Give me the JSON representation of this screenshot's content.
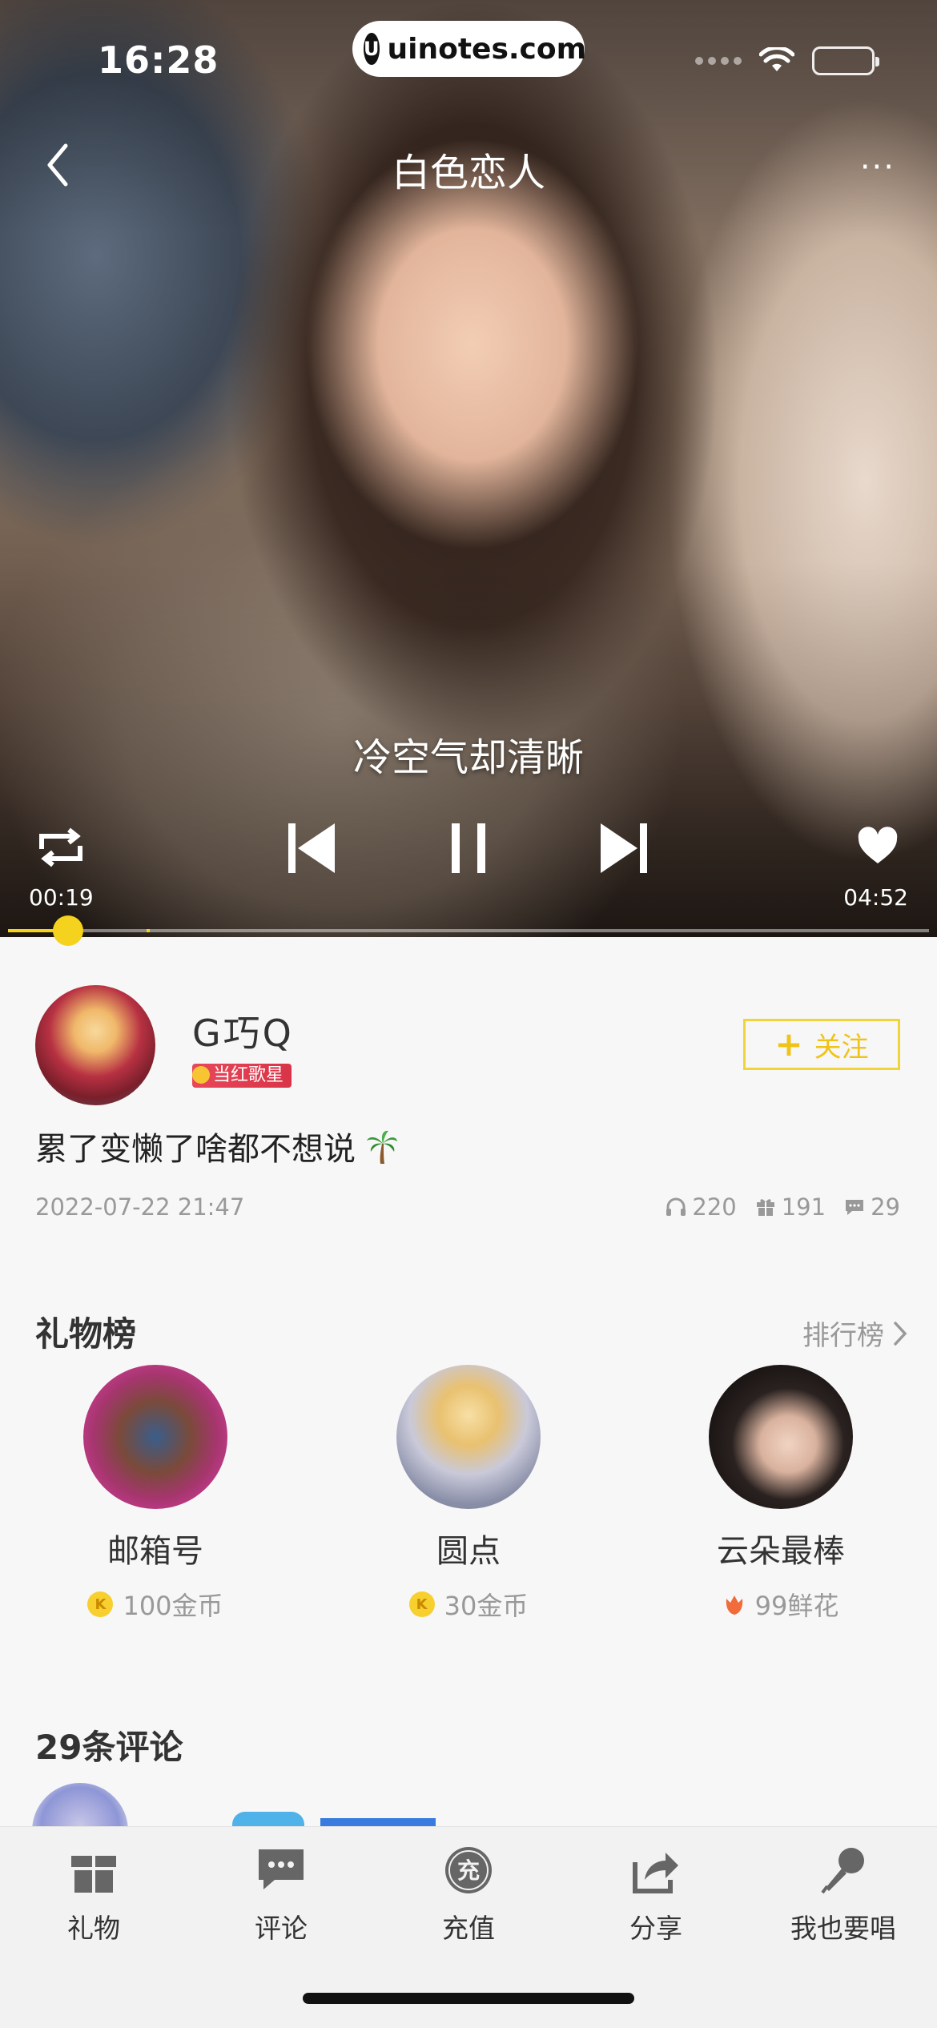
{
  "status_bar": {
    "time": "16:28",
    "url": "uinotes.com"
  },
  "player": {
    "title": "白色恋人",
    "lyric": "冷空气却清晰",
    "time_current": "00:19",
    "time_total": "04:52",
    "progress_fraction": 0.065,
    "buffer_fraction": 0.15,
    "accent_color": "#f5d21d"
  },
  "user": {
    "name": "G巧Q",
    "badge": "当红歌星",
    "follow_label": "关注",
    "description": "累了变懒了啥都不想说",
    "date": "2022-07-22 21:47",
    "stats": {
      "listens": "220",
      "gifts": "191",
      "comments": "29"
    }
  },
  "gift_rank": {
    "title": "礼物榜",
    "link_label": "排行榜",
    "items": [
      {
        "name": "邮箱号",
        "amount": "100金币",
        "currency_icon": "coin-icon"
      },
      {
        "name": "圆点",
        "amount": "30金币",
        "currency_icon": "coin-icon"
      },
      {
        "name": "云朵最棒",
        "amount": "99鲜花",
        "currency_icon": "flower-icon"
      }
    ]
  },
  "comments": {
    "title": "29条评论"
  },
  "tabbar": {
    "items": [
      {
        "label": "礼物",
        "icon": "gift-icon"
      },
      {
        "label": "评论",
        "icon": "comment-icon"
      },
      {
        "label": "充值",
        "icon": "recharge-icon",
        "glyph": "充"
      },
      {
        "label": "分享",
        "icon": "share-icon"
      },
      {
        "label": "我也要唱",
        "icon": "microphone-icon"
      }
    ]
  }
}
